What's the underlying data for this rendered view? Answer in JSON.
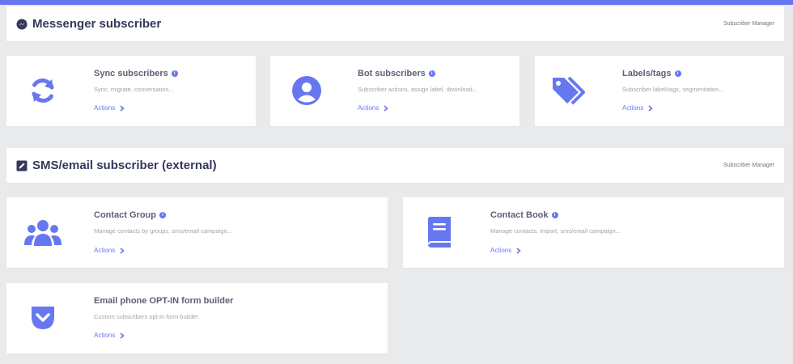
{
  "colors": {
    "accent": "#6777ef",
    "background": "#e9eaeb"
  },
  "sections": [
    {
      "title": "Messenger subscriber",
      "icon": "messenger-icon",
      "link": "Subscriber Manager"
    },
    {
      "title": "SMS/email subscriber (external)",
      "icon": "edit-square-icon",
      "link": "Subscriber Manager"
    }
  ],
  "cards": {
    "sync": {
      "title": "Sync subscribers",
      "desc": "Sync, migrate, conversation...",
      "action": "Actions",
      "icon": "sync-icon"
    },
    "bot": {
      "title": "Bot subscribers",
      "desc": "Subscriber actions, assign label, download...",
      "action": "Actions",
      "icon": "user-circle-icon"
    },
    "labels": {
      "title": "Labels/tags",
      "desc": "Subscriber label/tags, segmentation...",
      "action": "Actions",
      "icon": "tags-icon"
    },
    "group": {
      "title": "Contact Group",
      "desc": "Manage contacts by groups, sms/email campaign...",
      "action": "Actions",
      "icon": "users-icon"
    },
    "book": {
      "title": "Contact Book",
      "desc": "Manage contacts, import, sms/email campaign...",
      "action": "Actions",
      "icon": "book-icon"
    },
    "optin": {
      "title": "Email phone OPT-IN form builder",
      "desc": "Custom subscribers opt-in form builder.",
      "action": "Actions",
      "icon": "pocket-icon"
    }
  }
}
